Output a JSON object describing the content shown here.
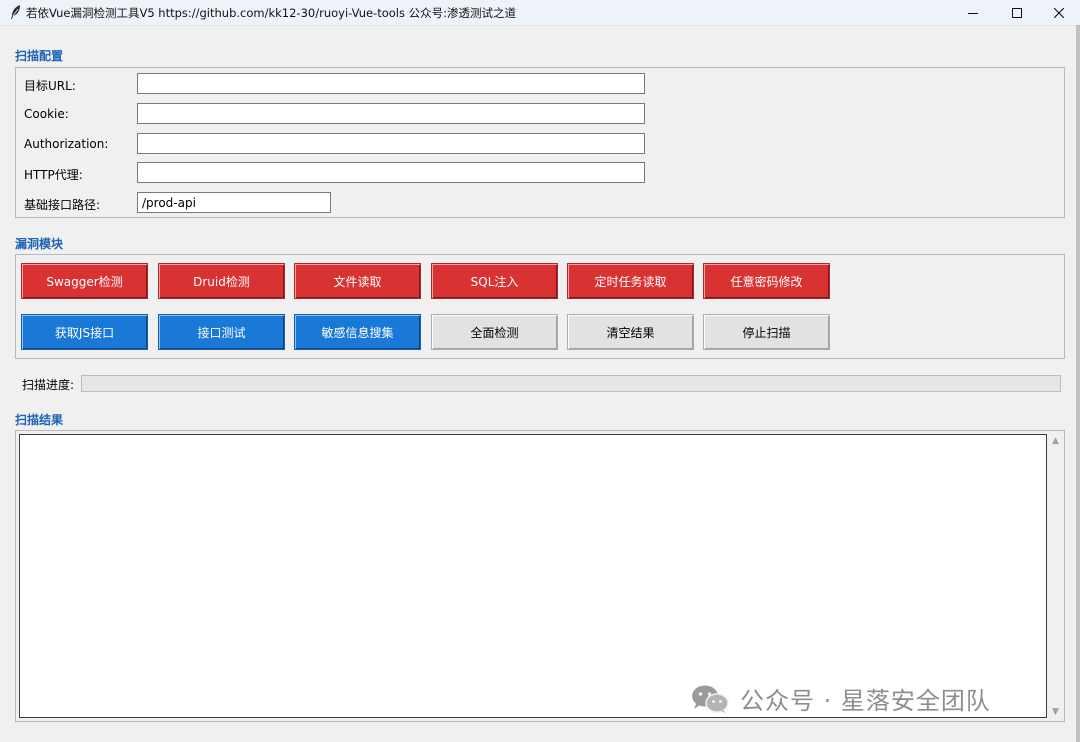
{
  "window": {
    "title": "若依Vue漏洞检测工具V5     https://github.com/kk12-30/ruoyi-Vue-tools     公众号:渗透测试之道",
    "controls": {
      "minimize": "minimize-icon",
      "maximize": "maximize-icon",
      "close": "close-icon"
    }
  },
  "scan_config": {
    "label": "扫描配置",
    "fields": [
      {
        "label": "目标URL:",
        "value": ""
      },
      {
        "label": "Cookie:",
        "value": ""
      },
      {
        "label": "Authorization:",
        "value": ""
      },
      {
        "label": "HTTP代理:",
        "value": ""
      },
      {
        "label": "基础接口路径:",
        "value": "/prod-api"
      }
    ]
  },
  "vuln_modules": {
    "label": "漏洞模块",
    "row1": [
      "Swagger检测",
      "Druid检测",
      "文件读取",
      "SQL注入",
      "定时任务读取",
      "任意密码修改"
    ],
    "row2": [
      "获取JS接口",
      "接口测试",
      "敏感信息搜集",
      "全面检测",
      "清空结果",
      "停止扫描"
    ]
  },
  "progress": {
    "label": "扫描进度:",
    "value": 0
  },
  "results": {
    "label": "扫描结果",
    "content": ""
  },
  "watermark": {
    "text": "公众号 · 星落安全团队",
    "icon": "wechat-icon"
  },
  "colors": {
    "section_label": "#1e63b4",
    "red_button": "#d93232",
    "blue_button": "#1a78d6",
    "gray_button": "#e2e2e2"
  }
}
